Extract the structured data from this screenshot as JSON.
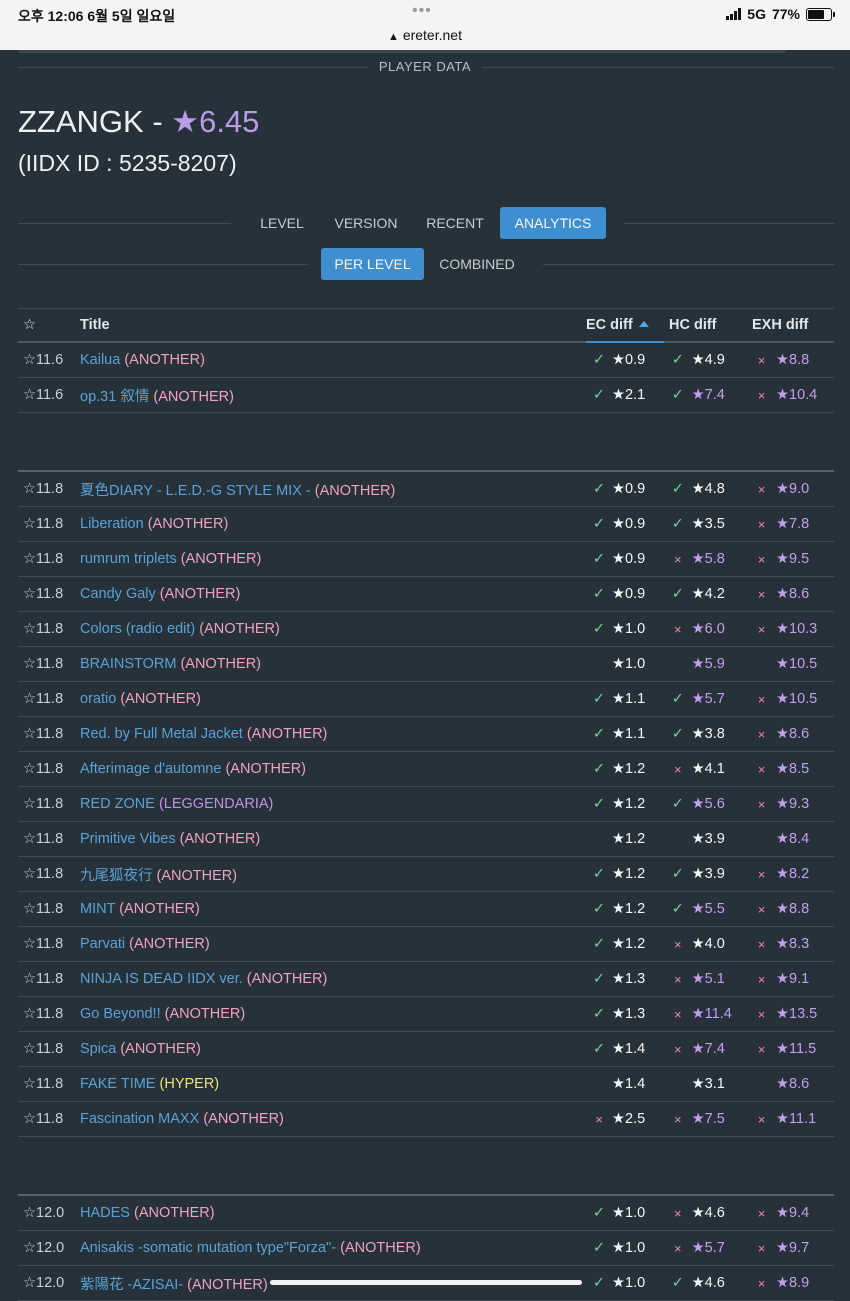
{
  "status_bar": {
    "time": "오후 12:06  6월 5일 일요일",
    "network": "5G",
    "battery": "77%",
    "url": "ereter.net"
  },
  "section_title": "PLAYER DATA",
  "player": {
    "name": "ZZANGK - ",
    "rating": "★6.45",
    "iidx_id": "(IIDX ID : 5235-8207)"
  },
  "tabs": [
    "LEVEL",
    "VERSION",
    "RECENT",
    "ANALYTICS"
  ],
  "subtabs": [
    "PER LEVEL",
    "COMBINED"
  ],
  "columns": {
    "star": "☆",
    "title": "Title",
    "ec": "EC diff",
    "hc": "HC diff",
    "exh": "EXH diff"
  },
  "colors": {
    "accent": "#3e8ed0",
    "link": "#5aa2d6",
    "another": "#f2a2bd",
    "hyper": "#ece37a",
    "leggendaria": "#c591e8",
    "check": "#6fd68d",
    "cross": "#f08aa0",
    "purple_star": "#c69eee"
  },
  "groups": [
    {
      "rows": [
        [
          "☆11.6",
          "Kailua",
          "(ANOTHER)",
          "ano",
          "✓",
          "★0.9",
          "w",
          "✓",
          "★4.9",
          "w",
          "×",
          "★8.8",
          "p"
        ],
        [
          "☆11.6",
          "op.31 叙情",
          "(ANOTHER)",
          "ano",
          "✓",
          "★2.1",
          "w",
          "✓",
          "★7.4",
          "p",
          "×",
          "★10.4",
          "p"
        ]
      ]
    },
    {
      "rows": [
        [
          "☆11.8",
          "夏色DIARY - L.E.D.-G STYLE MIX -",
          "(ANOTHER)",
          "ano",
          "✓",
          "★0.9",
          "w",
          "✓",
          "★4.8",
          "w",
          "×",
          "★9.0",
          "p"
        ],
        [
          "☆11.8",
          "Liberation",
          "(ANOTHER)",
          "ano",
          "✓",
          "★0.9",
          "w",
          "✓",
          "★3.5",
          "w",
          "×",
          "★7.8",
          "p"
        ],
        [
          "☆11.8",
          "rumrum triplets",
          "(ANOTHER)",
          "ano",
          "✓",
          "★0.9",
          "w",
          "×",
          "★5.8",
          "p",
          "×",
          "★9.5",
          "p"
        ],
        [
          "☆11.8",
          "Candy Galy",
          "(ANOTHER)",
          "ano",
          "✓",
          "★0.9",
          "w",
          "✓",
          "★4.2",
          "w",
          "×",
          "★8.6",
          "p"
        ],
        [
          "☆11.8",
          "Colors (radio edit)",
          "(ANOTHER)",
          "ano",
          "✓",
          "★1.0",
          "w",
          "×",
          "★6.0",
          "p",
          "×",
          "★10.3",
          "p"
        ],
        [
          "☆11.8",
          "BRAINSTORM",
          "(ANOTHER)",
          "ano",
          "",
          "★1.0",
          "w",
          "",
          "★5.9",
          "p",
          "",
          "★10.5",
          "p"
        ],
        [
          "☆11.8",
          "oratio",
          "(ANOTHER)",
          "ano",
          "✓",
          "★1.1",
          "w",
          "✓",
          "★5.7",
          "p",
          "×",
          "★10.5",
          "p"
        ],
        [
          "☆11.8",
          "Red. by Full Metal Jacket",
          "(ANOTHER)",
          "ano",
          "✓",
          "★1.1",
          "w",
          "✓",
          "★3.8",
          "w",
          "×",
          "★8.6",
          "p"
        ],
        [
          "☆11.8",
          "Afterimage d'automne",
          "(ANOTHER)",
          "ano",
          "✓",
          "★1.2",
          "w",
          "×",
          "★4.1",
          "w",
          "×",
          "★8.5",
          "p"
        ],
        [
          "☆11.8",
          "RED ZONE",
          "(LEGGENDARIA)",
          "leg",
          "✓",
          "★1.2",
          "w",
          "✓",
          "★5.6",
          "p",
          "×",
          "★9.3",
          "p"
        ],
        [
          "☆11.8",
          "Primitive Vibes",
          "(ANOTHER)",
          "ano",
          "",
          "★1.2",
          "w",
          "",
          "★3.9",
          "w",
          "",
          "★8.4",
          "p"
        ],
        [
          "☆11.8",
          "九尾狐夜行",
          "(ANOTHER)",
          "ano",
          "✓",
          "★1.2",
          "w",
          "✓",
          "★3.9",
          "w",
          "×",
          "★8.2",
          "p"
        ],
        [
          "☆11.8",
          "MINT",
          "(ANOTHER)",
          "ano",
          "✓",
          "★1.2",
          "w",
          "✓",
          "★5.5",
          "p",
          "×",
          "★8.8",
          "p"
        ],
        [
          "☆11.8",
          "Parvati",
          "(ANOTHER)",
          "ano",
          "✓",
          "★1.2",
          "w",
          "×",
          "★4.0",
          "w",
          "×",
          "★8.3",
          "p"
        ],
        [
          "☆11.8",
          "NINJA IS DEAD IIDX ver.",
          "(ANOTHER)",
          "ano",
          "✓",
          "★1.3",
          "w",
          "×",
          "★5.1",
          "p",
          "×",
          "★9.1",
          "p"
        ],
        [
          "☆11.8",
          "Go Beyond!!",
          "(ANOTHER)",
          "ano",
          "✓",
          "★1.3",
          "w",
          "×",
          "★11.4",
          "p",
          "×",
          "★13.5",
          "p"
        ],
        [
          "☆11.8",
          "Spica",
          "(ANOTHER)",
          "ano",
          "✓",
          "★1.4",
          "w",
          "×",
          "★7.4",
          "p",
          "×",
          "★11.5",
          "p"
        ],
        [
          "☆11.8",
          "FAKE TIME",
          "(HYPER)",
          "hyp",
          "",
          "★1.4",
          "w",
          "",
          "★3.1",
          "w",
          "",
          "★8.6",
          "p"
        ],
        [
          "☆11.8",
          "Fascination MAXX",
          "(ANOTHER)",
          "ano",
          "×",
          "★2.5",
          "w",
          "×",
          "★7.5",
          "p",
          "×",
          "★11.1",
          "p"
        ]
      ]
    },
    {
      "rows": [
        [
          "☆12.0",
          "HADES",
          "(ANOTHER)",
          "ano",
          "✓",
          "★1.0",
          "w",
          "×",
          "★4.6",
          "w",
          "×",
          "★9.4",
          "p"
        ],
        [
          "☆12.0",
          "Anisakis -somatic mutation type\"Forza\"-",
          "(ANOTHER)",
          "ano",
          "✓",
          "★1.0",
          "w",
          "×",
          "★5.7",
          "p",
          "×",
          "★9.7",
          "p"
        ],
        [
          "☆12.0",
          "紫陽花 -AZISAI-",
          "(ANOTHER)",
          "ano",
          "✓",
          "★1.0",
          "w",
          "✓",
          "★4.6",
          "w",
          "×",
          "★8.9",
          "p"
        ]
      ]
    }
  ]
}
